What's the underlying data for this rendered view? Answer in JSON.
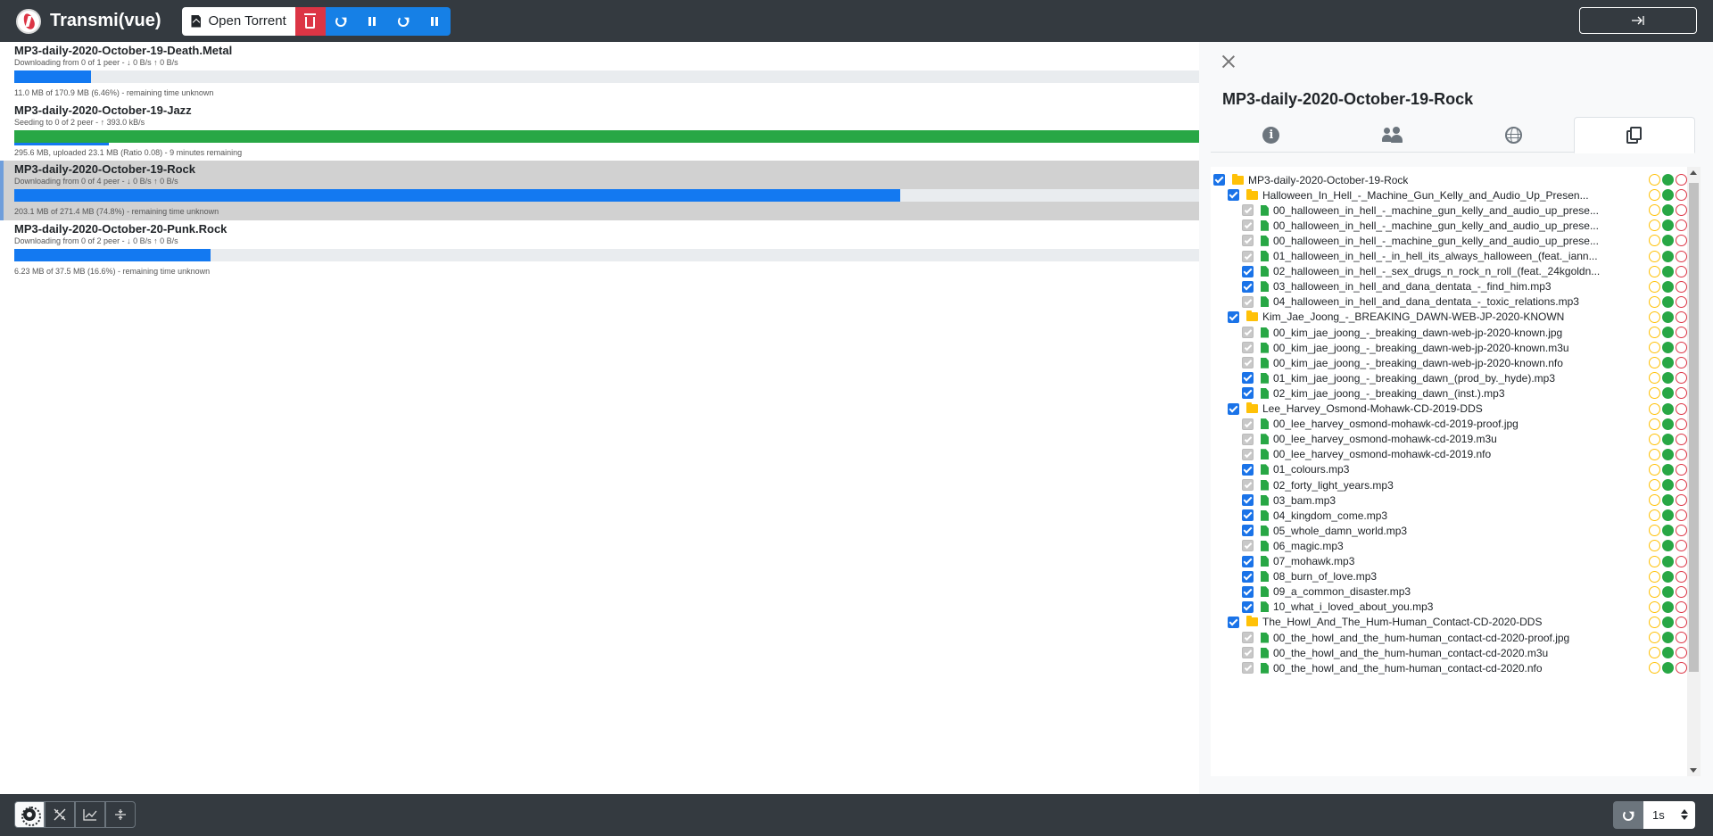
{
  "app": {
    "title": "Transmi(vue)"
  },
  "toolbar": {
    "open_label": "Open Torrent",
    "logout_icon": "sign-out-icon"
  },
  "torrents": [
    {
      "name": "MP3-daily-2020-October-19-Death.Metal",
      "status": "Downloading from 0 of 1 peer - ↓ 0 B/s ↑ 0 B/s",
      "info": "11.0 MB of 170.9 MB (6.46%) - remaining time unknown",
      "progress": 0.0646,
      "state": "downloading"
    },
    {
      "name": "MP3-daily-2020-October-19-Jazz",
      "status": "Seeding to 0 of 2 peer - ↑ 393.0 kB/s",
      "info": "295.6 MB, uploaded 23.1 MB (Ratio 0.08) - 9 minutes remaining",
      "progress": 1.0,
      "ratio_progress": 0.08,
      "state": "seeding"
    },
    {
      "name": "MP3-daily-2020-October-19-Rock",
      "status": "Downloading from 0 of 4 peer - ↓ 0 B/s ↑ 0 B/s",
      "info": "203.1 MB of 271.4 MB (74.8%) - remaining time unknown",
      "progress": 0.748,
      "state": "downloading",
      "selected": true
    },
    {
      "name": "MP3-daily-2020-October-20-Punk.Rock",
      "status": "Downloading from 0 of 2 peer - ↓ 0 B/s ↑ 0 B/s",
      "info": "6.23 MB of 37.5 MB (16.6%) - remaining time unknown",
      "progress": 0.166,
      "state": "downloading"
    }
  ],
  "details": {
    "title": "MP3-daily-2020-October-19-Rock",
    "tabs": [
      "info-icon",
      "peers-icon",
      "trackers-icon",
      "files-icon"
    ],
    "active_tab": 3,
    "files": [
      {
        "level": 0,
        "type": "folder",
        "checked": true,
        "name": "MP3-daily-2020-October-19-Rock"
      },
      {
        "level": 1,
        "type": "folder",
        "checked": true,
        "name": "Halloween_In_Hell_-_Machine_Gun_Kelly_and_Audio_Up_Presen..."
      },
      {
        "level": 2,
        "type": "file",
        "checked": false,
        "name": "00_halloween_in_hell_-_machine_gun_kelly_and_audio_up_prese..."
      },
      {
        "level": 2,
        "type": "file",
        "checked": false,
        "name": "00_halloween_in_hell_-_machine_gun_kelly_and_audio_up_prese..."
      },
      {
        "level": 2,
        "type": "file",
        "checked": false,
        "name": "00_halloween_in_hell_-_machine_gun_kelly_and_audio_up_prese..."
      },
      {
        "level": 2,
        "type": "file",
        "checked": false,
        "name": "01_halloween_in_hell_-_in_hell_its_always_halloween_(feat._iann..."
      },
      {
        "level": 2,
        "type": "file",
        "checked": true,
        "name": "02_halloween_in_hell_-_sex_drugs_n_rock_n_roll_(feat._24kgoldn..."
      },
      {
        "level": 2,
        "type": "file",
        "checked": true,
        "name": "03_halloween_in_hell_and_dana_dentata_-_find_him.mp3"
      },
      {
        "level": 2,
        "type": "file",
        "checked": false,
        "name": "04_halloween_in_hell_and_dana_dentata_-_toxic_relations.mp3"
      },
      {
        "level": 1,
        "type": "folder",
        "checked": true,
        "name": "Kim_Jae_Joong_-_BREAKING_DAWN-WEB-JP-2020-KNOWN"
      },
      {
        "level": 2,
        "type": "file",
        "checked": false,
        "name": "00_kim_jae_joong_-_breaking_dawn-web-jp-2020-known.jpg"
      },
      {
        "level": 2,
        "type": "file",
        "checked": false,
        "name": "00_kim_jae_joong_-_breaking_dawn-web-jp-2020-known.m3u"
      },
      {
        "level": 2,
        "type": "file",
        "checked": false,
        "name": "00_kim_jae_joong_-_breaking_dawn-web-jp-2020-known.nfo"
      },
      {
        "level": 2,
        "type": "file",
        "checked": true,
        "name": "01_kim_jae_joong_-_breaking_dawn_(prod_by._hyde).mp3"
      },
      {
        "level": 2,
        "type": "file",
        "checked": true,
        "name": "02_kim_jae_joong_-_breaking_dawn_(inst.).mp3"
      },
      {
        "level": 1,
        "type": "folder",
        "checked": true,
        "name": "Lee_Harvey_Osmond-Mohawk-CD-2019-DDS"
      },
      {
        "level": 2,
        "type": "file",
        "checked": false,
        "name": "00_lee_harvey_osmond-mohawk-cd-2019-proof.jpg"
      },
      {
        "level": 2,
        "type": "file",
        "checked": false,
        "name": "00_lee_harvey_osmond-mohawk-cd-2019.m3u"
      },
      {
        "level": 2,
        "type": "file",
        "checked": false,
        "name": "00_lee_harvey_osmond-mohawk-cd-2019.nfo"
      },
      {
        "level": 2,
        "type": "file",
        "checked": true,
        "name": "01_colours.mp3"
      },
      {
        "level": 2,
        "type": "file",
        "checked": false,
        "name": "02_forty_light_years.mp3"
      },
      {
        "level": 2,
        "type": "file",
        "checked": true,
        "name": "03_bam.mp3"
      },
      {
        "level": 2,
        "type": "file",
        "checked": true,
        "name": "04_kingdom_come.mp3"
      },
      {
        "level": 2,
        "type": "file",
        "checked": true,
        "name": "05_whole_damn_world.mp3"
      },
      {
        "level": 2,
        "type": "file",
        "checked": false,
        "name": "06_magic.mp3"
      },
      {
        "level": 2,
        "type": "file",
        "checked": true,
        "name": "07_mohawk.mp3"
      },
      {
        "level": 2,
        "type": "file",
        "checked": true,
        "name": "08_burn_of_love.mp3"
      },
      {
        "level": 2,
        "type": "file",
        "checked": true,
        "name": "09_a_common_disaster.mp3"
      },
      {
        "level": 2,
        "type": "file",
        "checked": true,
        "name": "10_what_i_loved_about_you.mp3"
      },
      {
        "level": 1,
        "type": "folder",
        "checked": true,
        "name": "The_Howl_And_The_Hum-Human_Contact-CD-2020-DDS"
      },
      {
        "level": 2,
        "type": "file",
        "checked": false,
        "name": "00_the_howl_and_the_hum-human_contact-cd-2020-proof.jpg"
      },
      {
        "level": 2,
        "type": "file",
        "checked": false,
        "name": "00_the_howl_and_the_hum-human_contact-cd-2020.m3u"
      },
      {
        "level": 2,
        "type": "file",
        "checked": false,
        "name": "00_the_howl_and_the_hum-human_contact-cd-2020.nfo"
      }
    ]
  },
  "footer": {
    "buttons": [
      "settings-icon",
      "tools-icon",
      "chart-icon",
      "split-icon"
    ],
    "refresh_interval": "1s"
  },
  "colors": {
    "navbar": "#343a40",
    "download": "#1379f1",
    "seed": "#28a745",
    "danger": "#dc3545"
  }
}
